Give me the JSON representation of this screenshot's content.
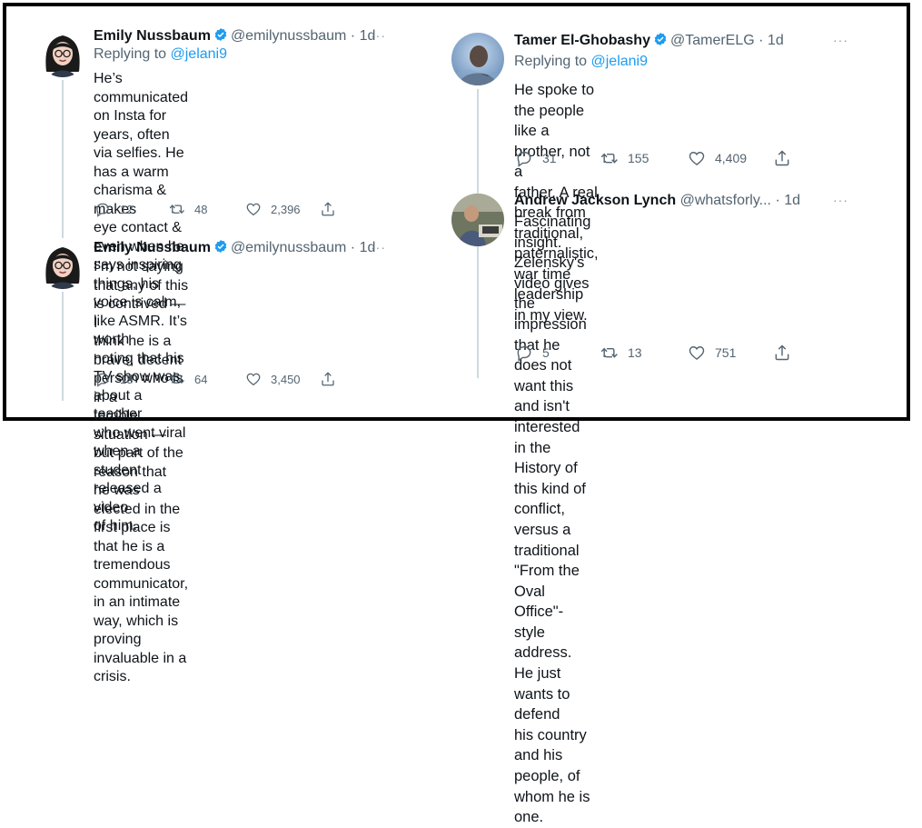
{
  "tweets": [
    {
      "name": "Emily Nussbaum",
      "handle": "@emilynussbaum",
      "dot": "·",
      "time": "1d",
      "more": "···",
      "replying_prefix": "Replying to ",
      "replying_to": "@jelani9",
      "lines": [
        "He’s communicated on Insta for years, often",
        "via selfies. He has a warm charisma & makes",
        "eye contact & even when he says inspiring",
        "things, his voice is calm, like ASMR. It’s worth",
        "noting that his TV show was about a teacher",
        "who went viral when a student released a video",
        "of him."
      ],
      "replies": "12",
      "retweets": "48",
      "likes": "2,396"
    },
    {
      "name": "Emily Nussbaum",
      "handle": "@emilynussbaum",
      "dot": "·",
      "time": "1d",
      "more": "···",
      "lines": [
        "I’m not saying that any of this is contrived — I",
        "think he is a brave, decent person who is in a",
        "terrible situation — but part of the reason that",
        "he was elected in the first place is that he is a",
        "tremendous communicator, in an intimate",
        "way, which is proving invaluable in a crisis."
      ],
      "replies": "18",
      "retweets": "64",
      "likes": "3,450"
    },
    {
      "name": "Tamer El-Ghobashy",
      "handle": "@TamerELG",
      "dot": "·",
      "time": "1d",
      "more": "···",
      "replying_prefix": "Replying to ",
      "replying_to": "@jelani9",
      "lines": [
        "He spoke to the people like a brother, not a",
        "father. A real break from traditional,",
        "paternalistic, war time leadership in my view."
      ],
      "replies": "31",
      "retweets": "155",
      "likes": "4,409"
    },
    {
      "name": "Andrew Jackson Lynch",
      "handle": "@whatsforly...",
      "dot": "·",
      "time": "1d",
      "more": "···",
      "lines": [
        "Fascinating insight. Zelensky's video gives the",
        "impression that he does not want this and isn't",
        "interested in the History of this kind of",
        "conflict, versus a traditional \"From the Oval",
        "Office\"-style address. He just wants to defend",
        "his country and his people, of whom he is one."
      ],
      "replies": "5",
      "retweets": "13",
      "likes": "751"
    }
  ],
  "colors": {
    "link": "#1d9bf0",
    "muted": "#536471",
    "verified": "#1d9bf0",
    "thread": "#cfd9de"
  },
  "icons": {
    "reply": "reply-icon",
    "retweet": "retweet-icon",
    "like": "like-icon",
    "share": "share-icon",
    "verified": "verified-badge-icon"
  }
}
